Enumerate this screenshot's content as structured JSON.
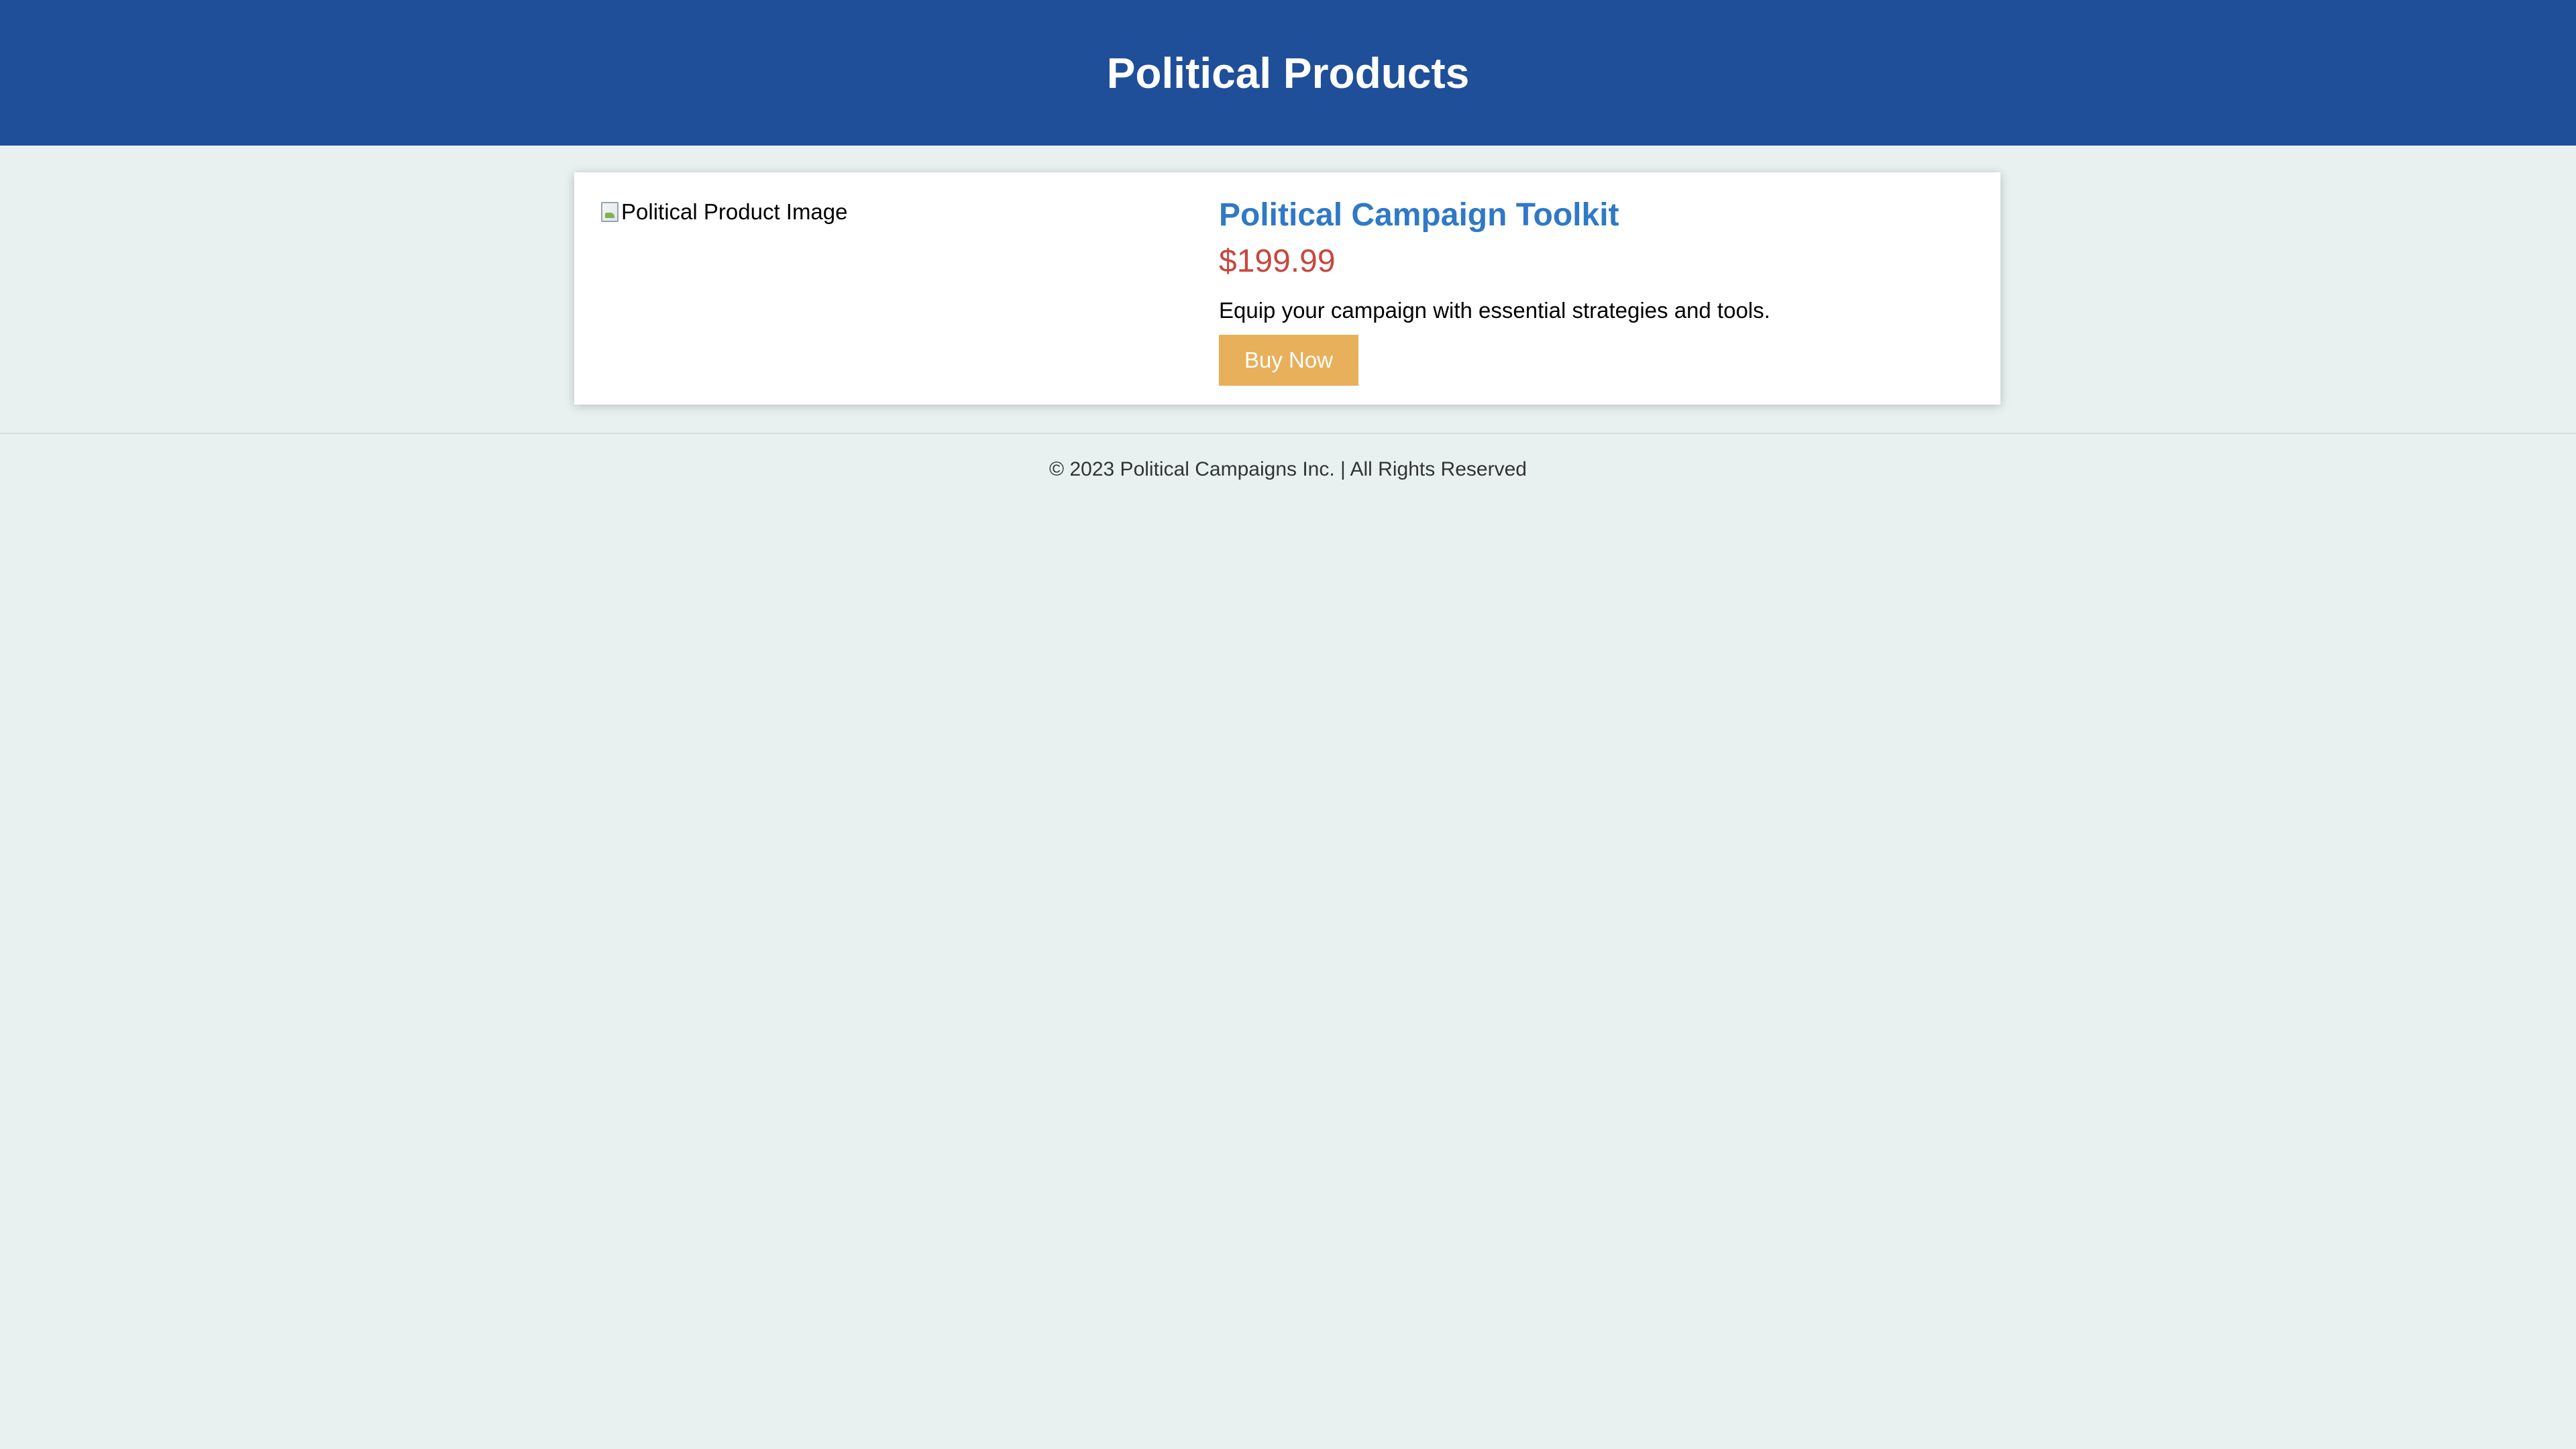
{
  "header": {
    "title": "Political Products"
  },
  "product": {
    "image_alt": "Political Product Image",
    "image_icon": "broken-image-icon",
    "name": "Political Campaign Toolkit",
    "price": "$199.99",
    "description": "Equip your campaign with essential strategies and tools.",
    "buy_label": "Buy Now"
  },
  "footer": {
    "text": "© 2023 Political Campaigns Inc. | All Rights Reserved"
  },
  "colors": {
    "header_bg": "#1f4f99",
    "page_bg": "#e8f1f0",
    "title": "#2f79c6",
    "price": "#c9463f",
    "button_bg": "#e8b05b"
  }
}
